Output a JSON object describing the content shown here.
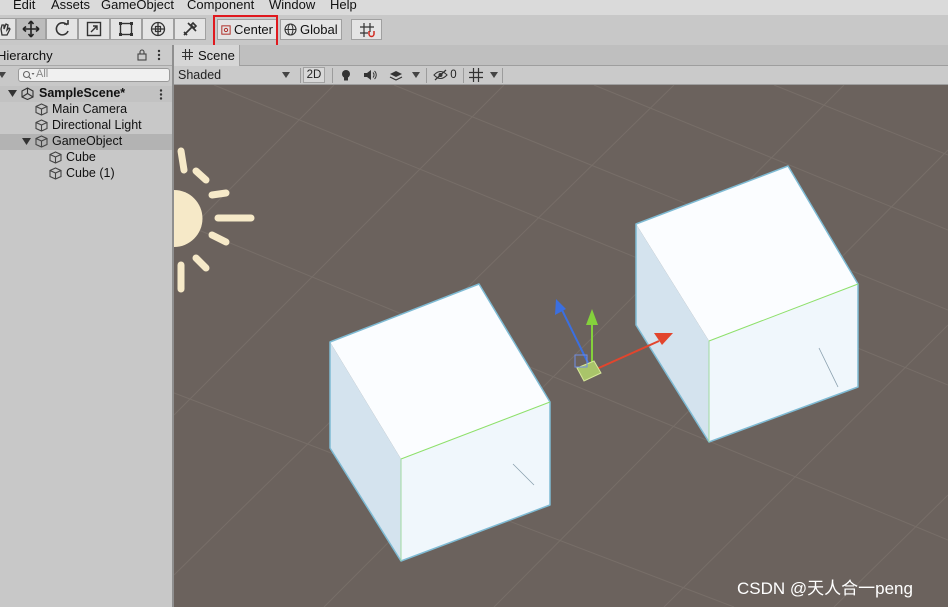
{
  "menu": [
    "Edit",
    "Assets",
    "GameObject",
    "Component",
    "Window",
    "Help"
  ],
  "toolbar": {
    "tools": [
      "hand-tool",
      "move-tool",
      "rotate-tool",
      "scale-tool",
      "rect-tool",
      "transform-tool",
      "custom-tool"
    ],
    "pivot_label": "Center",
    "space_label": "Global"
  },
  "hierarchy": {
    "title": "Hierarchy",
    "search_placeholder": "All",
    "scene_name": "SampleScene*",
    "items": [
      {
        "label": "Main Camera"
      },
      {
        "label": "Directional Light"
      },
      {
        "label": "GameObject"
      },
      {
        "label": "Cube"
      },
      {
        "label": "Cube (1)"
      }
    ]
  },
  "scene": {
    "tab_label": "Scene",
    "shading_mode": "Shaded",
    "mode_2d": "2D",
    "hidden_count": "0"
  },
  "watermark": "CSDN @天人合一peng",
  "colors": {
    "highlight": "#e0191e",
    "viewport_bg": "#6b625d",
    "x_axis": "#e2452d",
    "y_axis": "#84d13c",
    "z_axis": "#3b6fe0"
  }
}
